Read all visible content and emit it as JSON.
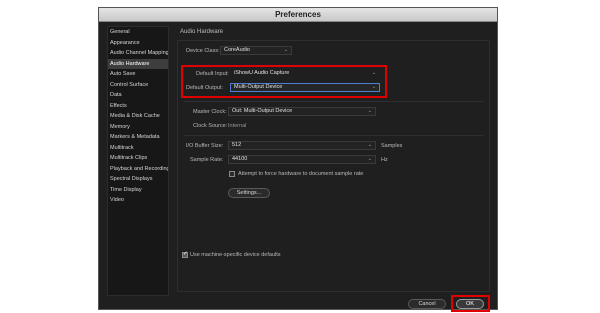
{
  "window": {
    "title": "Preferences"
  },
  "sidebar": {
    "items": [
      {
        "label": "General"
      },
      {
        "label": "Appearance"
      },
      {
        "label": "Audio Channel Mapping"
      },
      {
        "label": "Audio Hardware"
      },
      {
        "label": "Auto Save"
      },
      {
        "label": "Control Surface"
      },
      {
        "label": "Data"
      },
      {
        "label": "Effects"
      },
      {
        "label": "Media & Disk Cache"
      },
      {
        "label": "Memory"
      },
      {
        "label": "Markers & Metadata"
      },
      {
        "label": "Multitrack"
      },
      {
        "label": "Multitrack Clips"
      },
      {
        "label": "Playback and Recording"
      },
      {
        "label": "Spectral Displays"
      },
      {
        "label": "Time Display"
      },
      {
        "label": "Video"
      }
    ],
    "selected": "Audio Hardware"
  },
  "audio_hardware": {
    "header": "Audio Hardware",
    "device_class_label": "Device Class:",
    "device_class_value": "CoreAudio",
    "default_input_label": "Default Input:",
    "default_input_value": "iShowU Audio Capture",
    "default_output_label": "Default Output:",
    "default_output_value": "Multi-Output Device",
    "master_clock_label": "Master Clock:",
    "master_clock_value": "Out: Multi-Output Device",
    "clock_source_label": "Clock Source:",
    "clock_source_value": "Internal",
    "io_buffer_label": "I/O Buffer Size:",
    "io_buffer_value": "512",
    "io_buffer_unit": "Samples",
    "sample_rate_label": "Sample Rate:",
    "sample_rate_value": "44100",
    "sample_rate_unit": "Hz",
    "attempt_force_label": "Attempt to force hardware to document sample rate",
    "attempt_force_checked": false,
    "settings_button": "Settings...",
    "machine_specific_label": "Use machine-specific device defaults",
    "machine_specific_checked": true
  },
  "footer": {
    "cancel_label": "Cancel",
    "ok_label": "OK"
  },
  "colors": {
    "highlight_box": "#e00000",
    "focus_border": "#4c7fd1"
  }
}
